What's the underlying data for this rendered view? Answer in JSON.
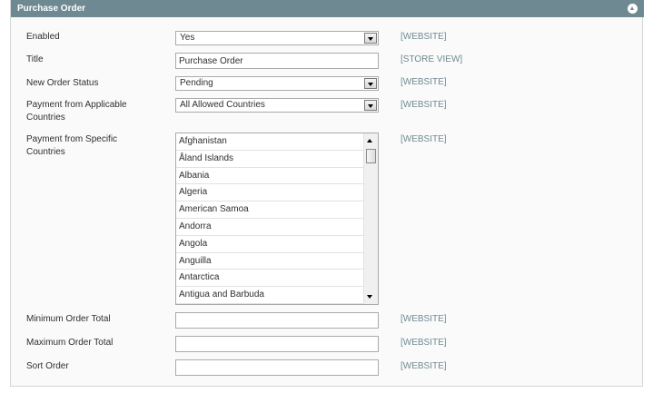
{
  "section": {
    "title": "Purchase Order",
    "collapse_icon": "chevron-up-icon"
  },
  "fields": {
    "enabled": {
      "label": "Enabled",
      "value": "Yes",
      "scope": "[WEBSITE]"
    },
    "title": {
      "label": "Title",
      "value": "Purchase Order",
      "scope": "[STORE VIEW]"
    },
    "new_order_status": {
      "label": "New Order Status",
      "value": "Pending",
      "scope": "[WEBSITE]"
    },
    "applicable_countries": {
      "label": "Payment from Applicable Countries",
      "value": "All Allowed Countries",
      "scope": "[WEBSITE]"
    },
    "specific_countries": {
      "label": "Payment from Specific Countries",
      "scope": "[WEBSITE]",
      "options": [
        "Afghanistan",
        "Åland Islands",
        "Albania",
        "Algeria",
        "American Samoa",
        "Andorra",
        "Angola",
        "Anguilla",
        "Antarctica",
        "Antigua and Barbuda"
      ]
    },
    "min_order_total": {
      "label": "Minimum Order Total",
      "value": "",
      "scope": "[WEBSITE]"
    },
    "max_order_total": {
      "label": "Maximum Order Total",
      "value": "",
      "scope": "[WEBSITE]"
    },
    "sort_order": {
      "label": "Sort Order",
      "value": "",
      "scope": "[WEBSITE]"
    }
  },
  "colors": {
    "header_bg": "#6f8992",
    "scope_text": "#6f8992",
    "panel_bg": "#fafafa"
  }
}
